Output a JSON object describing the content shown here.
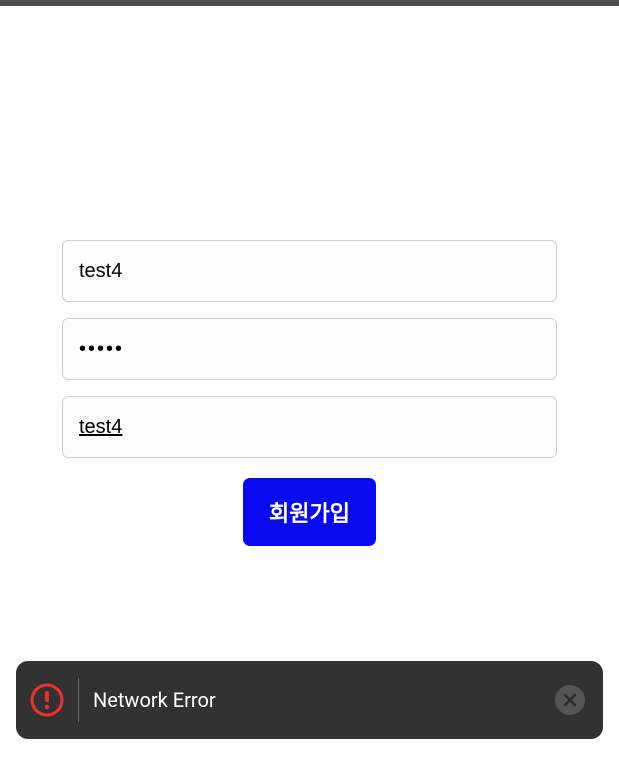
{
  "form": {
    "username_value": "test4",
    "password_value": "•••••",
    "nickname_value": "test4",
    "submit_label": "회원가입"
  },
  "toast": {
    "message": "Network Error"
  }
}
